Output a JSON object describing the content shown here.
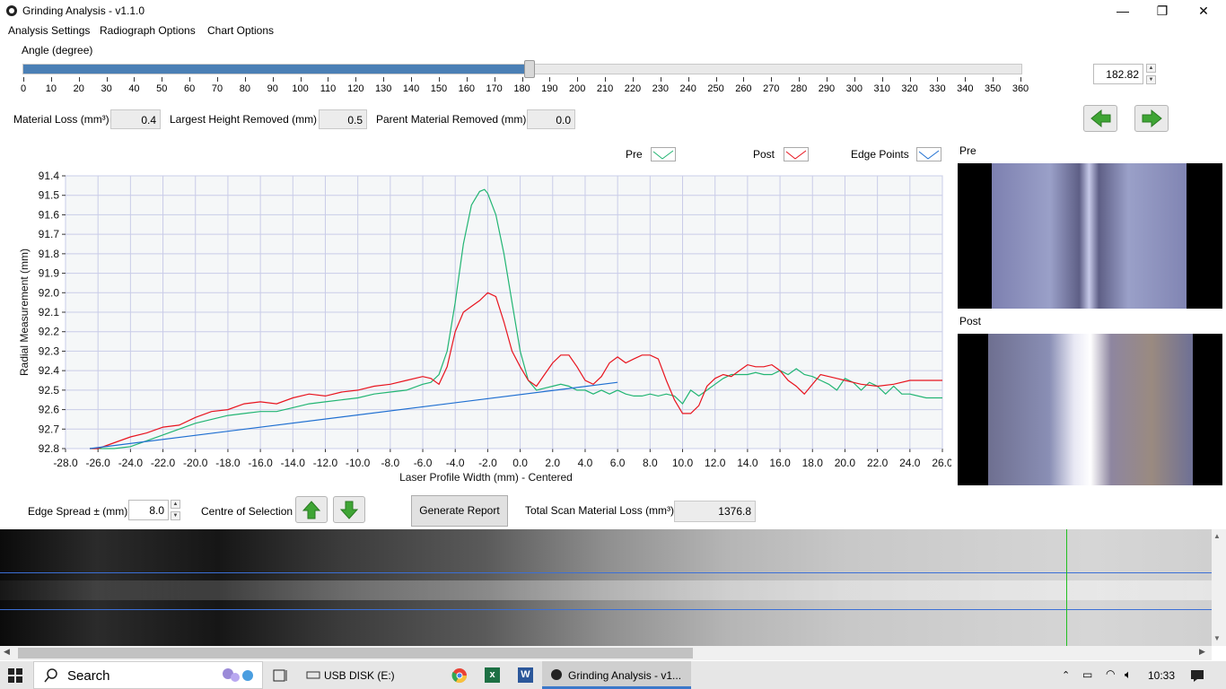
{
  "window": {
    "title": "Grinding Analysis - v1.1.0",
    "controls": [
      "—",
      "❐",
      "✕"
    ]
  },
  "menu": [
    "Analysis Settings",
    "Radiograph Options",
    "Chart Options"
  ],
  "angle": {
    "label": "Angle (degree)",
    "value": "182.82",
    "fraction": 0.5078,
    "tick_labels": [
      "0",
      "10",
      "20",
      "30",
      "40",
      "50",
      "60",
      "70",
      "80",
      "90",
      "100",
      "110",
      "120",
      "130",
      "140",
      "150",
      "160",
      "170",
      "180",
      "190",
      "200",
      "210",
      "220",
      "230",
      "240",
      "250",
      "260",
      "270",
      "280",
      "290",
      "300",
      "310",
      "320",
      "330",
      "340",
      "350",
      "360"
    ]
  },
  "metrics": {
    "material_loss_label": "Material Loss (mm³)",
    "material_loss_value": "0.4",
    "largest_height_label": "Largest Height Removed (mm)",
    "largest_height_value": "0.5",
    "parent_material_label": "Parent Material Removed (mm)",
    "parent_material_value": "0.0"
  },
  "legend": {
    "pre": "Pre",
    "post": "Post",
    "edge": "Edge Points"
  },
  "panels": {
    "pre_label": "Pre",
    "post_label": "Post"
  },
  "bottom": {
    "edge_spread_label": "Edge Spread ± (mm)",
    "edge_spread_value": "8.0",
    "centre_label": "Centre of Selection",
    "generate_report": "Generate Report",
    "total_loss_label": "Total Scan Material Loss (mm³)",
    "total_loss_value": "1376.8"
  },
  "taskbar": {
    "search": "Search",
    "usb": "USB DISK (E:)",
    "app": "Grinding Analysis - v1...",
    "time": "10:33"
  },
  "colors": {
    "pre": "#22b573",
    "post": "#e8141e",
    "edge": "#1f6fd1",
    "accent": "#4a7fb5"
  },
  "chart_data": {
    "type": "line",
    "xlabel": "Laser Profile Width (mm) - Centered",
    "ylabel": "Radial Measurement (mm)",
    "xlim": [
      -28,
      26
    ],
    "ylim": [
      92.8,
      91.4
    ],
    "y_inverted": true,
    "grid": true,
    "legend_position": "top",
    "x_ticks": [
      "-28.0",
      "-26.0",
      "-24.0",
      "-22.0",
      "-20.0",
      "-18.0",
      "-16.0",
      "-14.0",
      "-12.0",
      "-10.0",
      "-8.0",
      "-6.0",
      "-4.0",
      "-2.0",
      "0.0",
      "2.0",
      "4.0",
      "6.0",
      "8.0",
      "10.0",
      "12.0",
      "14.0",
      "16.0",
      "18.0",
      "20.0",
      "22.0",
      "24.0",
      "26.0"
    ],
    "y_ticks": [
      "91.4",
      "91.5",
      "91.6",
      "91.7",
      "91.8",
      "91.9",
      "92.0",
      "92.1",
      "92.2",
      "92.3",
      "92.4",
      "92.5",
      "92.6",
      "92.7",
      "92.8"
    ],
    "series": [
      {
        "name": "Pre",
        "x": [
          -26.5,
          -25,
          -24,
          -23,
          -22,
          -21,
          -20,
          -19,
          -18,
          -17,
          -16,
          -15,
          -14,
          -13,
          -12,
          -11,
          -10,
          -9,
          -8,
          -7,
          -6,
          -5.5,
          -5,
          -4.5,
          -4,
          -3.5,
          -3,
          -2.5,
          -2.2,
          -2,
          -1.5,
          -1,
          -0.5,
          0,
          0.5,
          1,
          1.5,
          2,
          2.5,
          3,
          3.5,
          4,
          4.5,
          5,
          5.5,
          6,
          6.5,
          7,
          7.5,
          8,
          8.5,
          9,
          9.5,
          10,
          10.5,
          11,
          11.5,
          12,
          12.5,
          13,
          13.5,
          14,
          14.5,
          15,
          15.5,
          16,
          16.5,
          17,
          17.5,
          18,
          18.5,
          19,
          19.5,
          20,
          20.5,
          21,
          21.5,
          22,
          22.5,
          23,
          23.5,
          24,
          25,
          26
        ],
        "y": [
          92.8,
          92.8,
          92.79,
          92.76,
          92.73,
          92.7,
          92.67,
          92.65,
          92.63,
          92.62,
          92.61,
          92.61,
          92.59,
          92.57,
          92.56,
          92.55,
          92.54,
          92.52,
          92.51,
          92.5,
          92.47,
          92.46,
          92.42,
          92.3,
          92.05,
          91.75,
          91.55,
          91.48,
          91.47,
          91.49,
          91.6,
          91.8,
          92.05,
          92.3,
          92.45,
          92.5,
          92.49,
          92.48,
          92.47,
          92.48,
          92.5,
          92.5,
          92.52,
          92.5,
          92.52,
          92.5,
          92.52,
          92.53,
          92.53,
          92.52,
          92.53,
          92.52,
          92.53,
          92.57,
          92.5,
          92.53,
          92.5,
          92.47,
          92.44,
          92.42,
          92.42,
          92.42,
          92.41,
          92.42,
          92.42,
          92.4,
          92.42,
          92.39,
          92.42,
          92.43,
          92.45,
          92.47,
          92.5,
          92.44,
          92.46,
          92.5,
          92.46,
          92.48,
          92.52,
          92.48,
          92.52,
          92.52,
          92.54,
          92.54
        ]
      },
      {
        "name": "Post",
        "x": [
          -26.5,
          -26,
          -25,
          -24,
          -23,
          -22,
          -21,
          -20,
          -19,
          -18,
          -17,
          -16,
          -15,
          -14,
          -13,
          -12,
          -11,
          -10,
          -9,
          -8,
          -7,
          -6,
          -5.5,
          -5,
          -4.5,
          -4,
          -3.5,
          -3,
          -2.5,
          -2,
          -1.5,
          -1,
          -0.5,
          0,
          0.5,
          1,
          1.5,
          2,
          2.5,
          3,
          3.5,
          4,
          4.5,
          5,
          5.5,
          6,
          6.5,
          7,
          7.5,
          8,
          8.5,
          9,
          9.5,
          10,
          10.5,
          11,
          11.5,
          12,
          12.5,
          13,
          13.5,
          14,
          14.5,
          15,
          15.5,
          16,
          16.5,
          17,
          17.5,
          18,
          18.5,
          19,
          19.5,
          20,
          20.5,
          21,
          22,
          23,
          24,
          25,
          26
        ],
        "y": [
          92.8,
          92.8,
          92.77,
          92.74,
          92.72,
          92.69,
          92.68,
          92.64,
          92.61,
          92.6,
          92.57,
          92.56,
          92.57,
          92.54,
          92.52,
          92.53,
          92.51,
          92.5,
          92.48,
          92.47,
          92.45,
          92.43,
          92.44,
          92.47,
          92.38,
          92.2,
          92.1,
          92.07,
          92.04,
          92.0,
          92.02,
          92.15,
          92.3,
          92.38,
          92.45,
          92.48,
          92.42,
          92.36,
          92.32,
          92.32,
          92.38,
          92.45,
          92.47,
          92.43,
          92.36,
          92.33,
          92.36,
          92.34,
          92.32,
          92.32,
          92.34,
          92.45,
          92.55,
          92.62,
          92.62,
          92.58,
          92.48,
          92.44,
          92.42,
          92.43,
          92.4,
          92.37,
          92.38,
          92.38,
          92.37,
          92.4,
          92.45,
          92.48,
          92.52,
          92.47,
          92.42,
          92.43,
          92.44,
          92.45,
          92.46,
          92.47,
          92.48,
          92.47,
          92.45,
          92.45,
          92.45
        ]
      },
      {
        "name": "Edge Points",
        "x": [
          -26.5,
          6.0
        ],
        "y": [
          92.8,
          92.46
        ]
      }
    ]
  }
}
